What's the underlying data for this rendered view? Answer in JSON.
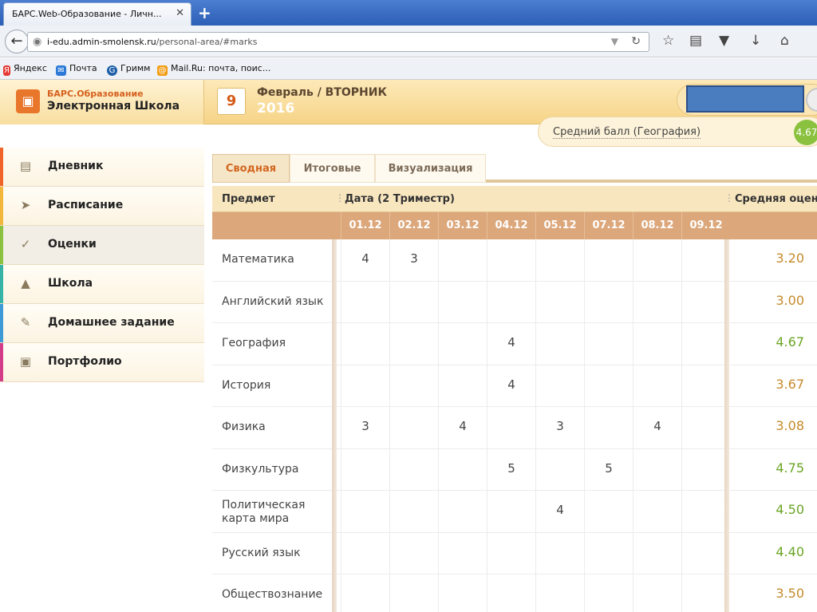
{
  "browser": {
    "tab_title": "БАРС.Web-Образование - Личн...",
    "tab_close": "✕",
    "new_tab": "+",
    "url_host": "i-edu.admin-smolensk.ru",
    "url_path": "/personal-area/#marks",
    "bookmarks": [
      {
        "label": "Яндекс",
        "icon": "yandex-icon",
        "color": "#e53935"
      },
      {
        "label": "Почта",
        "icon": "mail-icon",
        "color": "#2b7ad8"
      },
      {
        "label": "Гримм",
        "icon": "grimm-icon",
        "color": "#1e5fa8"
      },
      {
        "label": "Mail.Ru: почта, поис...",
        "icon": "mailru-icon",
        "color": "#f39c12"
      }
    ]
  },
  "header": {
    "logo_sub": "БАРС.Образование",
    "logo_main": "Электронная Школа",
    "day": "9",
    "month_weekday": "Февраль / ВТОРНИК",
    "year": "2016",
    "avg_label": "Средний балл (География)",
    "avg_value": "4.67"
  },
  "sidebar": {
    "items": [
      {
        "label": "Дневник",
        "icon": "book-icon",
        "color": "#f0642a"
      },
      {
        "label": "Расписание",
        "icon": "pin-icon",
        "color": "#f2b63a"
      },
      {
        "label": "Оценки",
        "icon": "check-icon",
        "color": "#8ac23f",
        "active": true
      },
      {
        "label": "Школа",
        "icon": "school-icon",
        "color": "#34b3a6"
      },
      {
        "label": "Домашнее задание",
        "icon": "homework-icon",
        "color": "#3d9ad6"
      },
      {
        "label": "Портфолио",
        "icon": "briefcase-icon",
        "color": "#d23c88"
      }
    ]
  },
  "tabs": [
    "Сводная",
    "Итоговые",
    "Визуализация"
  ],
  "table": {
    "col_subject": "Предмет",
    "col_dates": "Дата (2 Триместр)",
    "col_avg": "Средняя оценка",
    "dates": [
      "01.12",
      "02.12",
      "03.12",
      "04.12",
      "05.12",
      "07.12",
      "08.12",
      "09.12"
    ],
    "rows": [
      {
        "subject": "Математика",
        "marks": [
          "4",
          "3",
          "",
          "",
          "",
          "",
          "",
          ""
        ],
        "avg": "3.20",
        "avg_color": "#c58a2a"
      },
      {
        "subject": "Английский язык",
        "marks": [
          "",
          "",
          "",
          "",
          "",
          "",
          "",
          ""
        ],
        "avg": "3.00",
        "avg_color": "#c58a2a"
      },
      {
        "subject": "География",
        "marks": [
          "",
          "",
          "",
          "4",
          "",
          "",
          "",
          ""
        ],
        "avg": "4.67",
        "avg_color": "#6aa524"
      },
      {
        "subject": "История",
        "marks": [
          "",
          "",
          "",
          "4",
          "",
          "",
          "",
          ""
        ],
        "avg": "3.67",
        "avg_color": "#c58a2a"
      },
      {
        "subject": "Физика",
        "marks": [
          "3",
          "",
          "4",
          "",
          "3",
          "",
          "4",
          ""
        ],
        "avg": "3.08",
        "avg_color": "#c58a2a"
      },
      {
        "subject": "Физкультура",
        "marks": [
          "",
          "",
          "",
          "5",
          "",
          "5",
          "",
          ""
        ],
        "avg": "4.75",
        "avg_color": "#6aa524"
      },
      {
        "subject": "Политическая карта мира",
        "marks": [
          "",
          "",
          "",
          "",
          "4",
          "",
          "",
          ""
        ],
        "avg": "4.50",
        "avg_color": "#6aa524"
      },
      {
        "subject": "Русский язык",
        "marks": [
          "",
          "",
          "",
          "",
          "",
          "",
          "",
          ""
        ],
        "avg": "4.40",
        "avg_color": "#6aa524"
      },
      {
        "subject": "Обществознание",
        "marks": [
          "",
          "",
          "",
          "",
          "",
          "",
          "",
          ""
        ],
        "avg": "3.50",
        "avg_color": "#c58a2a"
      }
    ]
  }
}
